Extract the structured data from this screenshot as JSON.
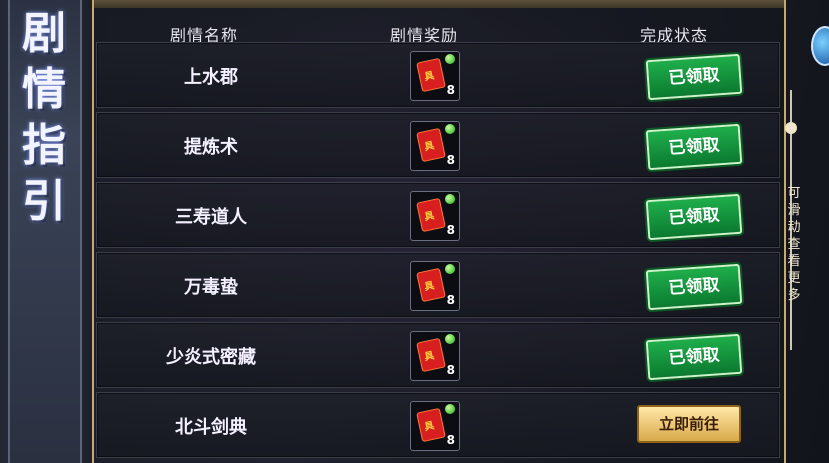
{
  "banner": {
    "title": "剧情指引"
  },
  "headers": {
    "name": "剧情名称",
    "reward": "剧情奖励",
    "status": "完成状态"
  },
  "rows": [
    {
      "name": "上水郡",
      "reward_count": "8",
      "status": "已领取"
    },
    {
      "name": "提炼术",
      "reward_count": "8",
      "status": "已领取"
    },
    {
      "name": "三寿道人",
      "reward_count": "8",
      "status": "已领取"
    },
    {
      "name": "万毒蛰",
      "reward_count": "8",
      "status": "已领取"
    },
    {
      "name": "少炎式密藏",
      "reward_count": "8",
      "status": "已领取"
    },
    {
      "name": "北斗剑典",
      "reward_count": "8",
      "status": "立即前往"
    }
  ],
  "scroll_hint": "可滑动查看更多",
  "reward_icon_glyph": "具",
  "colors": {
    "claimed": "#1fae4b",
    "go": "#d9a94a",
    "frame": "#c9a96a"
  }
}
